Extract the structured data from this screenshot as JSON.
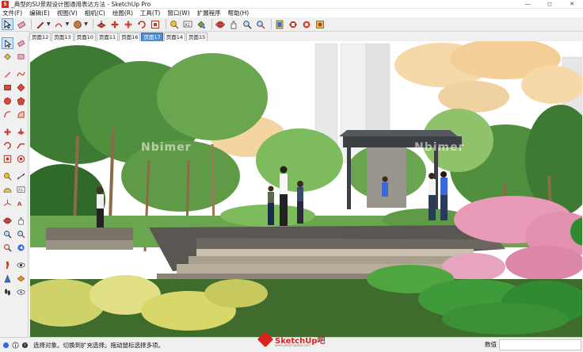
{
  "window": {
    "title": "_典型的SU景观设计图通用表达方法 - SketchUp Pro",
    "logo_letter": "S",
    "minimize": "—",
    "maximize": "◻",
    "close": "✕"
  },
  "menus": [
    "文件(F)",
    "编辑(E)",
    "视图(V)",
    "相机(C)",
    "绘图(R)",
    "工具(T)",
    "窗口(W)",
    "扩展程序",
    "帮助(H)"
  ],
  "scene_tabs": [
    {
      "label": "页面12",
      "active": false
    },
    {
      "label": "页面13",
      "active": false
    },
    {
      "label": "页面10",
      "active": false
    },
    {
      "label": "页面11",
      "active": false
    },
    {
      "label": "页面16",
      "active": false
    },
    {
      "label": "页面17",
      "active": true
    },
    {
      "label": "页面14",
      "active": false
    },
    {
      "label": "页面15",
      "active": false
    }
  ],
  "toolbar_icons": [
    "select-icon",
    "eraser-icon",
    "pencil-icon",
    "arc-icon",
    "rectangle-icon",
    "pushpull-icon",
    "move-icon",
    "rotate-icon",
    "scale-icon",
    "offset-icon",
    "tape-icon",
    "text-icon",
    "paint-icon",
    "orbit-icon",
    "pan-icon",
    "zoom-icon",
    "zoom-extents-icon",
    "warehouse-icon",
    "extension-icon",
    "component-icon",
    "style-icon"
  ],
  "palette_icons": [
    "select-icon",
    "eraser-icon",
    "pencil-icon",
    "freehand-icon",
    "rectangle-icon",
    "rotated-rect-icon",
    "circle-icon",
    "polygon-icon",
    "arc-icon",
    "pie-icon",
    "move-icon",
    "pushpull-icon",
    "rotate-icon",
    "followme-icon",
    "scale-icon",
    "offset-icon",
    "tape-icon",
    "dimension-icon",
    "protractor-icon",
    "text-icon",
    "axes-icon",
    "3dtext-icon",
    "orbit-icon",
    "pan-icon",
    "zoom-icon",
    "zoom-window-icon",
    "walk-icon",
    "lookaround-icon",
    "section-icon",
    "position-camera-icon"
  ],
  "status": {
    "text": "选择对象。切换到扩充选择。拖动鼠标选择多项。",
    "measure_label": "数值",
    "measure_value": ""
  },
  "watermark": {
    "brand": "SketchUp吧",
    "sub": "www.sketchupbar.com",
    "viewport_mark": "Nbimer"
  },
  "colors": {
    "sky": "#ffffff",
    "tab_active": "#4a90d9",
    "foliage_dark": "#2f6a2a",
    "foliage_light": "#8fc26b",
    "foliage_yellow": "#d8d86a",
    "foliage_peach": "#f6d9a8",
    "pink_flowers": "#e89ab8",
    "paving": "#5a5652",
    "pavilion": "#3c3f44",
    "ground": "#3f6b2c",
    "status_bg": "#f0f0f0"
  }
}
